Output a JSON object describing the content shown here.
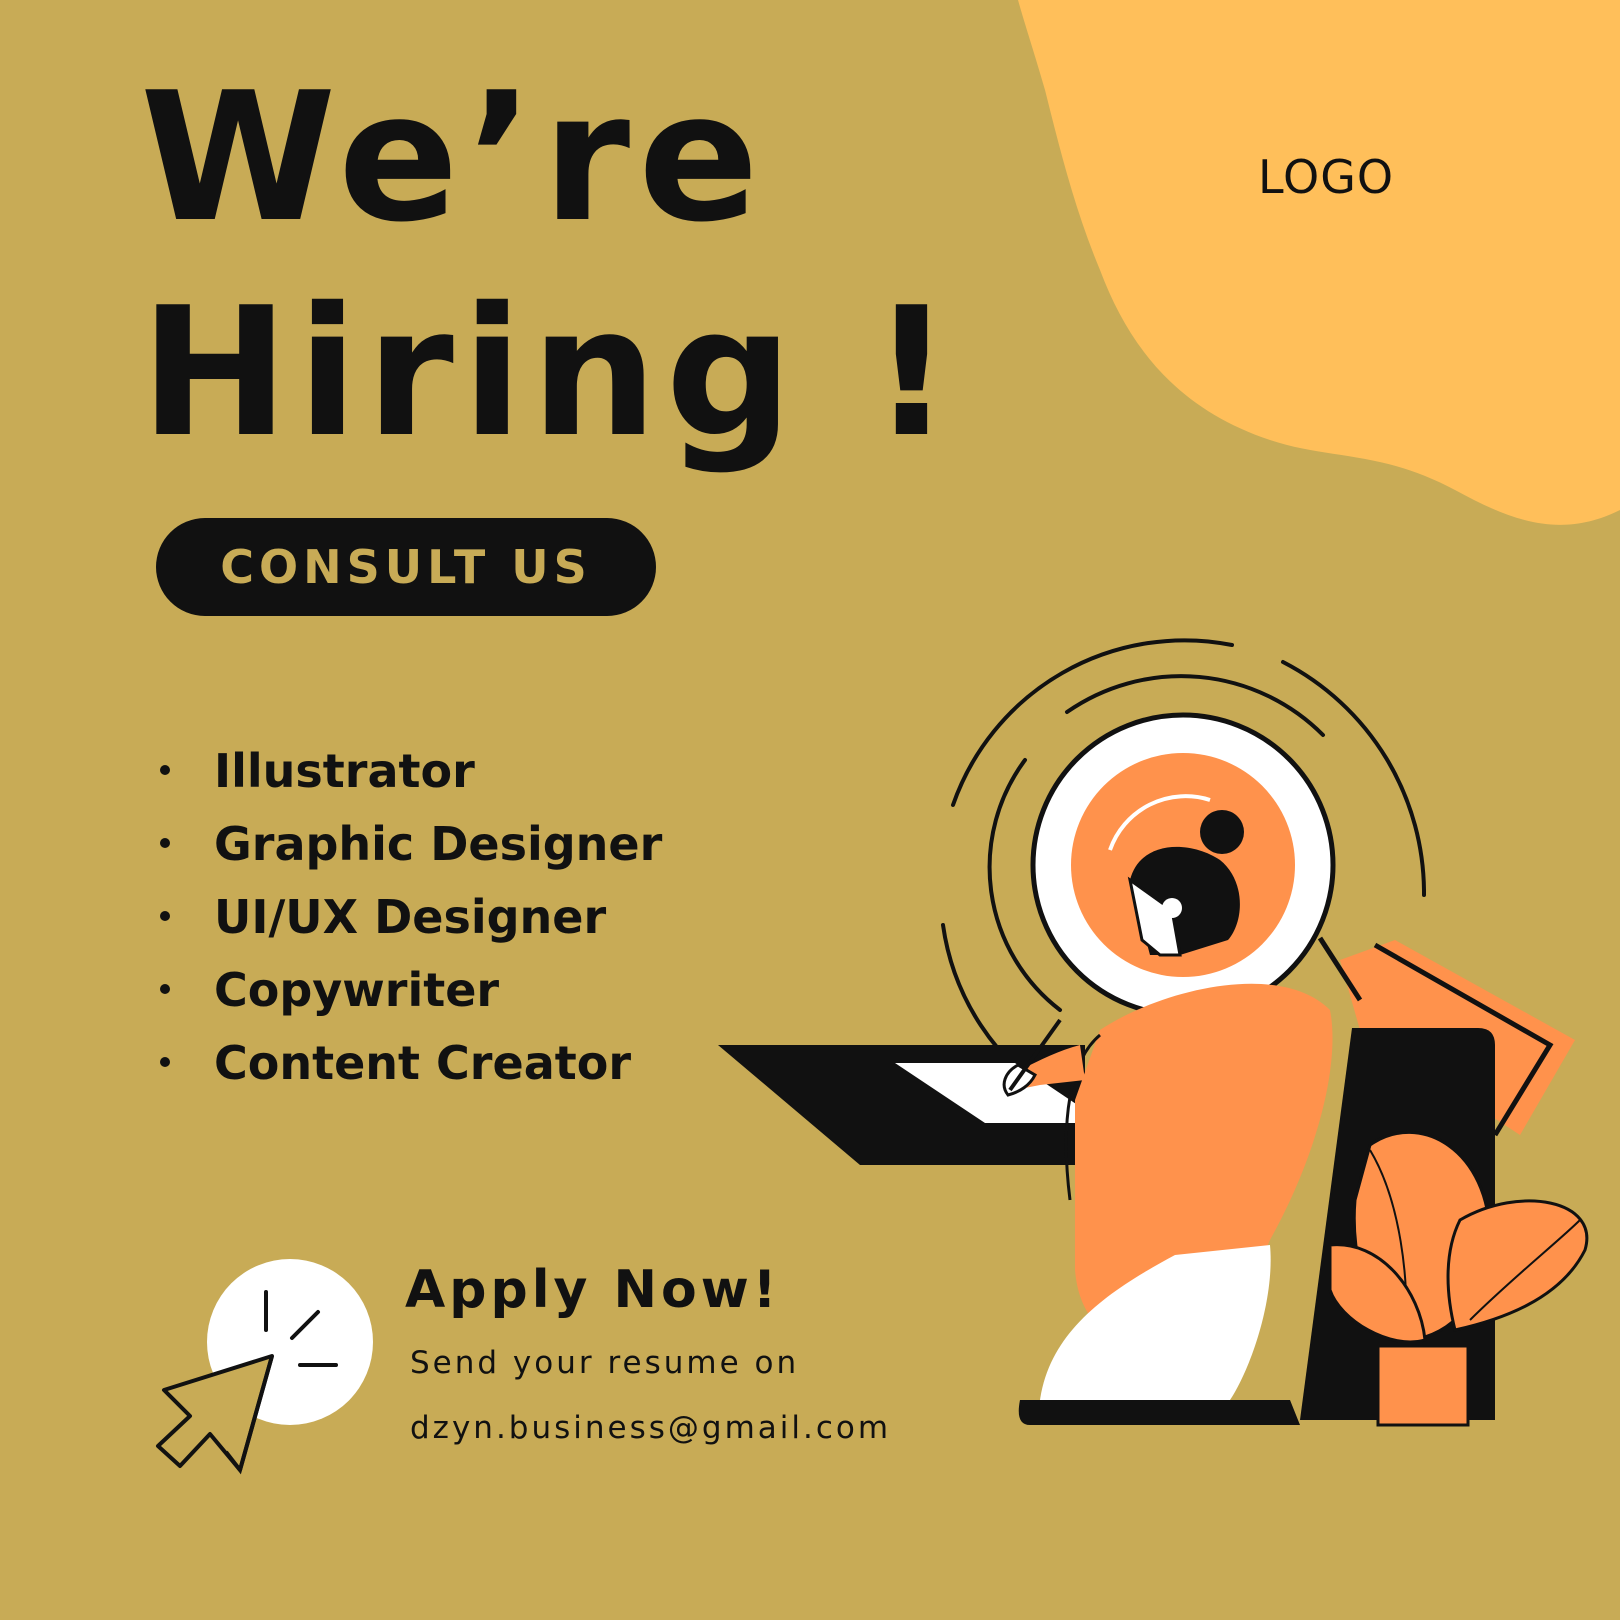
{
  "brand": {
    "logo": "LOGO"
  },
  "headline": {
    "line1": "We’re",
    "line2": "Hiring !"
  },
  "consult_button": {
    "label": "CONSULT US"
  },
  "roles": [
    "Illustrator",
    "Graphic Designer",
    "UI/UX Designer",
    "Copywriter",
    "Content Creator"
  ],
  "apply": {
    "title": "Apply Now!",
    "line1": "Send your resume on",
    "email": "dzyn.business@gmail.com"
  },
  "colors": {
    "background": "#C8AB56",
    "blob": "#FFBF5A",
    "orange": "#FF924C",
    "dark": "#111111",
    "white": "#FFFFFF"
  },
  "icons": [
    "cursor-click-icon",
    "woman-at-desk-illustration",
    "potted-plant-icon"
  ]
}
